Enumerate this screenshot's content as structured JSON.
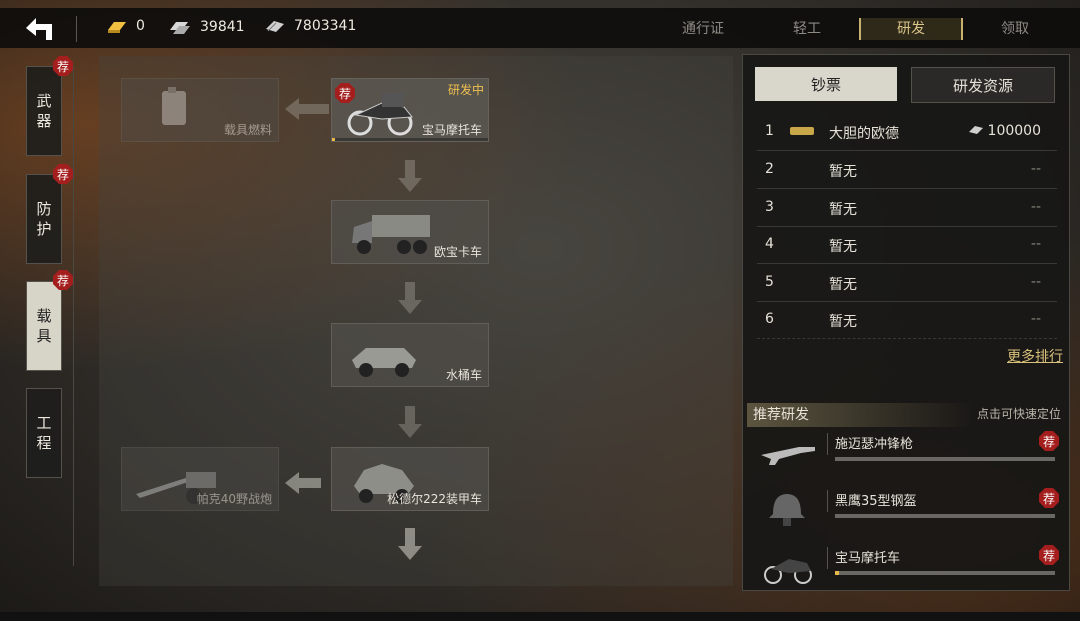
{
  "resources": {
    "gold": "0",
    "silver": "39841",
    "notes": "7803341"
  },
  "tabs": [
    {
      "label": "通行证"
    },
    {
      "label": "轻工"
    },
    {
      "label": "研发"
    },
    {
      "label": "领取"
    }
  ],
  "sidenav": [
    {
      "label_1": "武",
      "label_2": "器",
      "badge": "荐"
    },
    {
      "label_1": "防",
      "label_2": "护",
      "badge": "荐"
    },
    {
      "label_1": "载",
      "label_2": "具",
      "badge": "荐"
    },
    {
      "label_1": "工",
      "label_2": "程"
    }
  ],
  "tree": {
    "fuel": {
      "name": "载具燃料"
    },
    "bmw": {
      "name": "宝马摩托车",
      "status": "研发中",
      "badge": "荐",
      "progress": 0.02
    },
    "truck": {
      "name": "欧宝卡车"
    },
    "kubel": {
      "name": "水桶车"
    },
    "armored": {
      "name": "松德尔222装甲车"
    },
    "pak40": {
      "name": "帕克40野战炮"
    }
  },
  "panel": {
    "tab_active": "钞票",
    "tab_other": "研发资源",
    "ranks": [
      {
        "n": "1",
        "name": "大胆的欧德",
        "value": "100000"
      },
      {
        "n": "2",
        "name": "暂无",
        "value": "--"
      },
      {
        "n": "3",
        "name": "暂无",
        "value": "--"
      },
      {
        "n": "4",
        "name": "暂无",
        "value": "--"
      },
      {
        "n": "5",
        "name": "暂无",
        "value": "--"
      },
      {
        "n": "6",
        "name": "暂无",
        "value": "--"
      }
    ],
    "more": "更多排行",
    "rec_title": "推荐研发",
    "rec_hint": "点击可快速定位",
    "recs": [
      {
        "name": "施迈瑟冲锋枪",
        "badge": "荐",
        "progress": 0
      },
      {
        "name": "黑鹰35型钢盔",
        "badge": "荐",
        "progress": 0
      },
      {
        "name": "宝马摩托车",
        "badge": "荐",
        "progress": 0.02
      }
    ]
  },
  "colors": {
    "accent": "#d8c58a",
    "badge": "#a51e1e",
    "progress": "#e8b84a"
  }
}
